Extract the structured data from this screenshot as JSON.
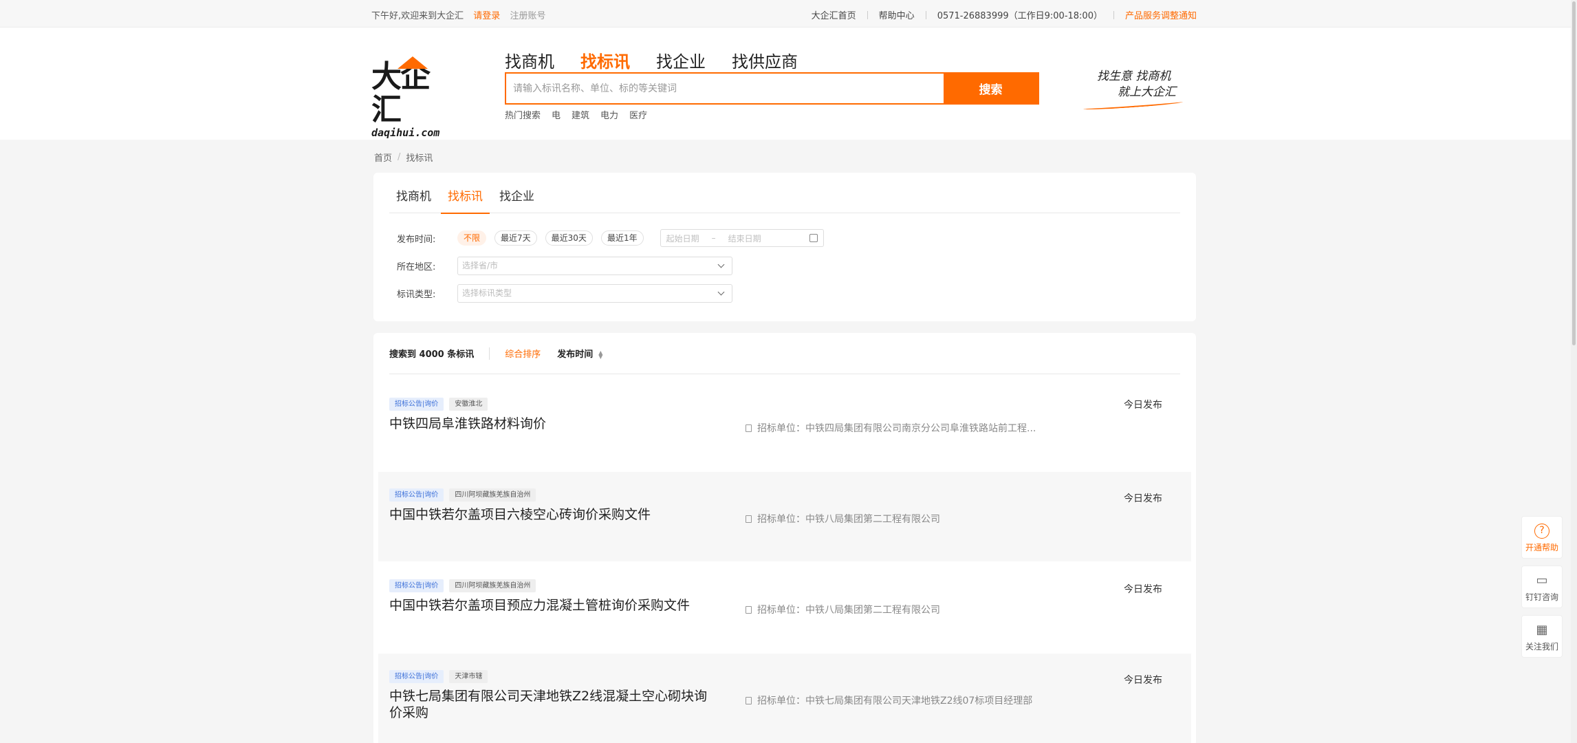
{
  "topbar": {
    "greeting": "下午好,欢迎来到大企汇",
    "login": "请登录",
    "register": "注册账号",
    "home": "大企汇首页",
    "help": "帮助中心",
    "phone": "0571-26883999（工作日9:00-18:00）",
    "notice": "产品服务调整通知"
  },
  "logo": {
    "cn": "大企汇",
    "en": "daqihui.com"
  },
  "nav": {
    "tabs": [
      {
        "label": "找商机"
      },
      {
        "label": "找标讯"
      },
      {
        "label": "找企业"
      },
      {
        "label": "找供应商"
      }
    ],
    "active_index": 1
  },
  "search": {
    "placeholder": "请输入标讯名称、单位、标的等关键词",
    "button": "搜索",
    "hot_label": "热门搜索",
    "hot_terms": [
      "电",
      "建筑",
      "电力",
      "医疗"
    ]
  },
  "slogan": {
    "line1": "找生意 找商机",
    "line2": "就上大企汇"
  },
  "breadcrumb": {
    "home": "首页",
    "current": "找标讯"
  },
  "filters": {
    "tabs": [
      {
        "label": "找商机"
      },
      {
        "label": "找标讯"
      },
      {
        "label": "找企业"
      }
    ],
    "active_tab": 1,
    "time_label": "发布时间:",
    "time_options": [
      "不限",
      "最近7天",
      "最近30天",
      "最近1年"
    ],
    "time_selected": 0,
    "date_start_placeholder": "起始日期",
    "date_end_placeholder": "结束日期",
    "region_label": "所在地区:",
    "region_placeholder": "选择省/市",
    "type_label": "标讯类型:",
    "type_placeholder": "选择标讯类型"
  },
  "results": {
    "count_text": "搜索到 4000 条标讯",
    "sort_default": "综合排序",
    "sort_time": "发布时间",
    "unit_label": "招标单位：",
    "items": [
      {
        "type_tag": "招标公告|询价",
        "region_tag": "安徽淮北",
        "title": "中铁四局阜淮铁路材料询价",
        "unit": "中铁四局集团有限公司南京分公司阜淮铁路站前工程...",
        "published": "今日发布"
      },
      {
        "type_tag": "招标公告|询价",
        "region_tag": "四川阿坝藏族羌族自治州",
        "title": "中国中铁若尔盖项目六棱空心砖询价采购文件",
        "unit": "中铁八局集团第二工程有限公司",
        "published": "今日发布"
      },
      {
        "type_tag": "招标公告|询价",
        "region_tag": "四川阿坝藏族羌族自治州",
        "title": "中国中铁若尔盖项目预应力混凝土管桩询价采购文件",
        "unit": "中铁八局集团第二工程有限公司",
        "published": "今日发布"
      },
      {
        "type_tag": "招标公告|询价",
        "region_tag": "天津市辖",
        "title": "中铁七局集团有限公司天津地铁Z2线混凝土空心砌块询价采购",
        "unit": "中铁七局集团有限公司天津地铁Z2线07标项目经理部",
        "published": "今日发布"
      }
    ]
  },
  "float": {
    "help": "开通帮助",
    "dingtalk": "钉钉咨询",
    "follow": "关注我们"
  },
  "colors": {
    "accent": "#ff6a00",
    "tag_blue": "#3b6fd8"
  }
}
